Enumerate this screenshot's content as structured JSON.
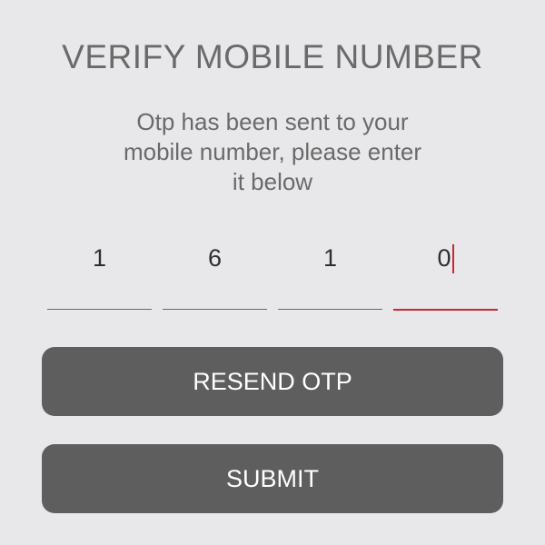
{
  "title": "VERIFY MOBILE NUMBER",
  "subtitle_lines": [
    "Otp has been sent to your",
    "mobile number, please enter",
    "it below"
  ],
  "otp": {
    "digits": [
      "1",
      "6",
      "1",
      "0"
    ],
    "active_index": 3
  },
  "buttons": {
    "resend_label": "RESEND OTP",
    "submit_label": "SUBMIT"
  },
  "colors": {
    "background": "#e8e8ea",
    "text": "#6a6a6a",
    "button": "#5e5e5e",
    "accent": "#c8273a"
  }
}
